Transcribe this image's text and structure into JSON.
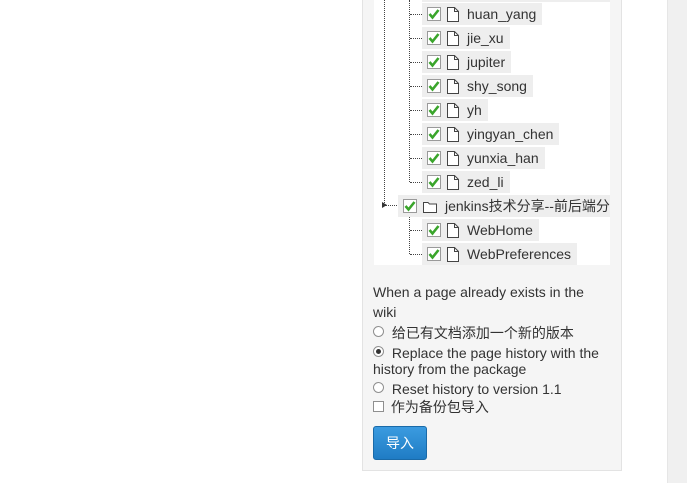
{
  "tree": {
    "children": [
      {
        "label": "huan_yang",
        "checked": true,
        "icon": "file-icon"
      },
      {
        "label": "jie_xu",
        "checked": true,
        "icon": "file-icon"
      },
      {
        "label": "jupiter",
        "checked": true,
        "icon": "file-icon"
      },
      {
        "label": "shy_song",
        "checked": true,
        "icon": "file-icon"
      },
      {
        "label": "yh",
        "checked": true,
        "icon": "file-icon"
      },
      {
        "label": "yingyan_chen",
        "checked": true,
        "icon": "file-icon"
      },
      {
        "label": "yunxia_han",
        "checked": true,
        "icon": "file-icon"
      },
      {
        "label": "zed_li",
        "checked": true,
        "icon": "file-icon"
      }
    ],
    "folder": {
      "label": "jenkins技术分享--前后端分离",
      "checked": true,
      "icon": "folder-icon"
    },
    "folder_children": [
      {
        "label": "WebHome",
        "checked": true,
        "icon": "file-icon"
      },
      {
        "label": "WebPreferences",
        "checked": true,
        "icon": "file-icon"
      }
    ],
    "check_color": "#3aa52b"
  },
  "existing_page": {
    "heading": "When a page already exists in the wiki",
    "options": [
      {
        "label": "给已有文档添加一个新的版本",
        "selected": false
      },
      {
        "label": "Replace the page history with the history from the package",
        "selected": true
      },
      {
        "label": "Reset history to version 1.1",
        "selected": false
      }
    ]
  },
  "backup": {
    "label": "作为备份包导入",
    "checked": false
  },
  "import_button": {
    "label": "导入",
    "color": "#2a88d4"
  }
}
